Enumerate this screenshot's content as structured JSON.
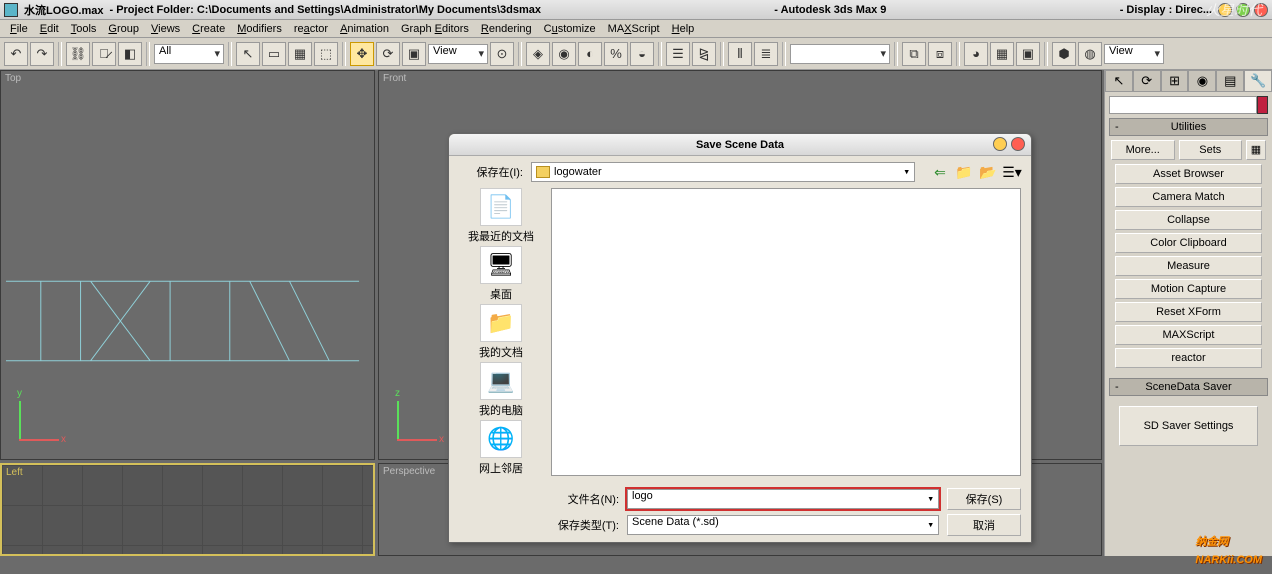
{
  "title": {
    "filename": "水流LOGO.max",
    "project": "- Project Folder: C:\\Documents and Settings\\Administrator\\My Documents\\3dsmax",
    "app": "- Autodesk 3ds Max 9",
    "display": "- Display : Direc..."
  },
  "menu": [
    "File",
    "Edit",
    "Tools",
    "Group",
    "Views",
    "Create",
    "Modifiers",
    "reactor",
    "Animation",
    "Graph Editors",
    "Rendering",
    "Customize",
    "MAXScript",
    "Help"
  ],
  "toolbar": {
    "combo1": "All",
    "combo2": "View",
    "combo3": "View"
  },
  "viewports": {
    "top": "Top",
    "front": "Front",
    "left": "Left",
    "persp": "Perspective",
    "axis_y": "y",
    "axis_x": "x",
    "axis_z": "z"
  },
  "panel": {
    "utilities_hdr": "Utilities",
    "more": "More...",
    "sets": "Sets",
    "buttons": [
      "Asset Browser",
      "Camera Match",
      "Collapse",
      "Color Clipboard",
      "Measure",
      "Motion Capture",
      "Reset XForm",
      "MAXScript",
      "reactor"
    ],
    "scenedata_hdr": "SceneData Saver",
    "sdsaver": "SD Saver Settings"
  },
  "dialog": {
    "title": "Save Scene Data",
    "save_in_label": "保存在(I):",
    "folder": "logowater",
    "places": [
      "我最近的文档",
      "桌面",
      "我的文档",
      "我的电脑",
      "网上邻居"
    ],
    "filename_label": "文件名(N):",
    "filename_value": "logo",
    "filetype_label": "保存类型(T):",
    "filetype_value": "Scene Data (*.sd)",
    "save_btn": "保存(S)",
    "cancel_btn": "取消"
  },
  "watermark": "NARKii.COM",
  "watermark_sub": "纳金网"
}
